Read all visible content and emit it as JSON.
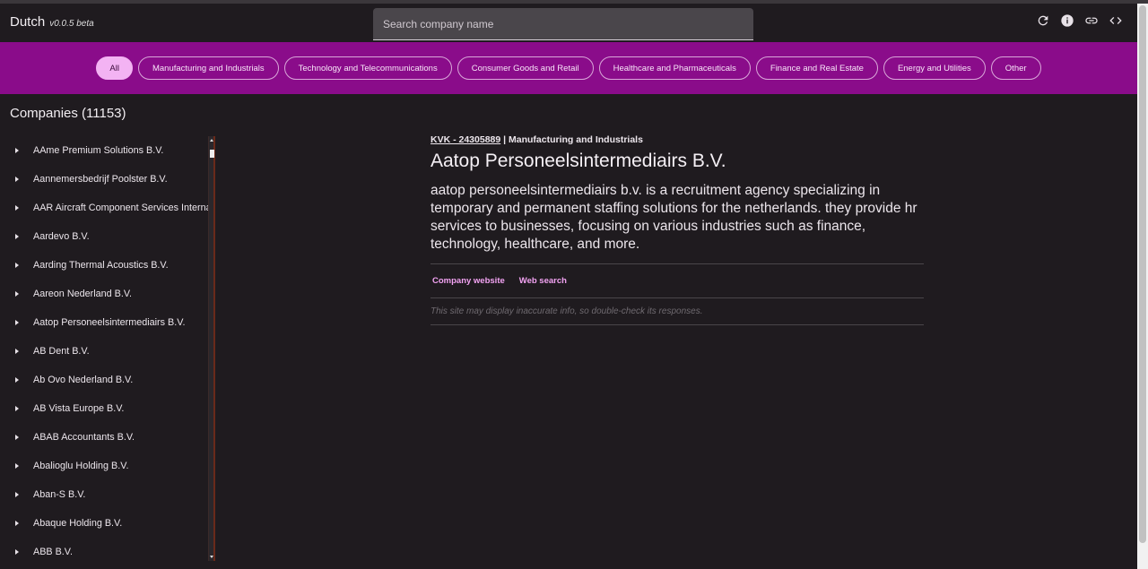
{
  "app": {
    "title": "Dutch",
    "version": "v0.0.5 beta"
  },
  "search": {
    "placeholder": "Search company name"
  },
  "actions": [
    {
      "icon": "refresh-icon"
    },
    {
      "icon": "info-icon"
    },
    {
      "icon": "link-icon"
    },
    {
      "icon": "code-icon"
    }
  ],
  "categories": [
    "All",
    "Manufacturing and Industrials",
    "Technology and Telecommunications",
    "Consumer Goods and Retail",
    "Healthcare and Pharmaceuticals",
    "Finance and Real Estate",
    "Energy and Utilities",
    "Other"
  ],
  "active_category": "All",
  "companies": {
    "title": "Companies (11153)",
    "items": [
      "AAme Premium Solutions B.V.",
      "Aannemersbedrijf Poolster B.V.",
      "AAR Aircraft Component Services International",
      "Aardevo B.V.",
      "Aarding Thermal Acoustics B.V.",
      "Aareon Nederland B.V.",
      "Aatop Personeelsintermediairs B.V.",
      "AB Dent B.V.",
      "Ab Ovo Nederland B.V.",
      "AB Vista Europe B.V.",
      "ABAB Accountants B.V.",
      "Abalioglu Holding B.V.",
      "Aban-S B.V.",
      "Abaque Holding B.V.",
      "ABB B.V."
    ]
  },
  "detail": {
    "kvk": "KVK - 24305889",
    "separator": " | ",
    "category": "Manufacturing and Industrials",
    "name": "Aatop Personeelsintermediairs B.V.",
    "description": "aatop personeelsintermediairs b.v. is a recruitment agency specializing in temporary and permanent staffing solutions for the netherlands. they provide hr services to businesses, focusing on various industries such as finance, technology, healthcare, and more.",
    "links": {
      "website": "Company website",
      "search": "Web search"
    },
    "disclaimer": "This site may display inaccurate info, so double-check its responses."
  },
  "colors": {
    "background": "#1f1b1f",
    "category_bar": "#8a0c8a",
    "active_chip": "#f3b3f3",
    "link": "#f3a3f3"
  }
}
